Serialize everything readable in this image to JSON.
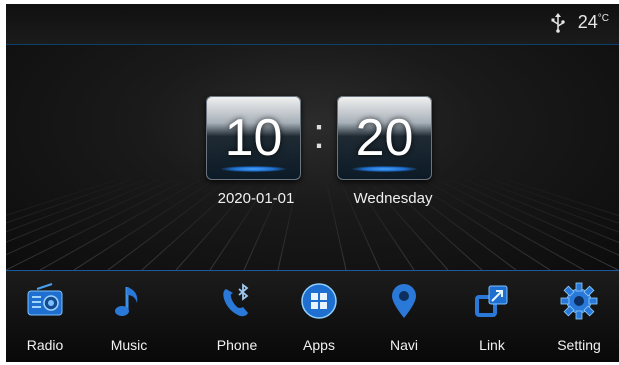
{
  "status": {
    "temperature": "24",
    "temp_unit": "°C",
    "icons": [
      "usb-icon"
    ]
  },
  "clock": {
    "hours": "10",
    "separator": ":",
    "minutes": "20",
    "date": "2020-01-01",
    "weekday": "Wednesday"
  },
  "dock": [
    {
      "label": "Radio",
      "icon": "radio-icon"
    },
    {
      "label": "Music",
      "icon": "music-note-icon"
    },
    {
      "label": "Phone",
      "icon": "bluetooth-phone-icon"
    },
    {
      "label": "Apps",
      "icon": "apps-grid-icon"
    },
    {
      "label": "Navi",
      "icon": "map-pin-icon"
    },
    {
      "label": "Link",
      "icon": "link-screens-icon"
    },
    {
      "label": "Setting",
      "icon": "gear-icon"
    }
  ],
  "colors": {
    "accent": "#1e6fd0",
    "background": "#111111",
    "text": "#f0f0f0"
  }
}
